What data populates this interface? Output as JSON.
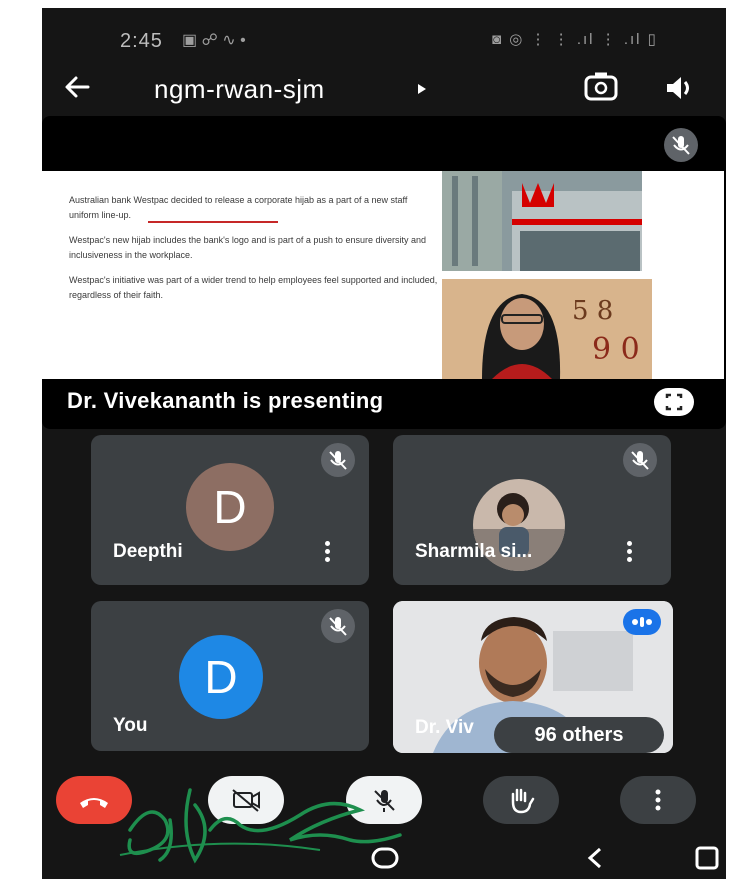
{
  "status_bar": {
    "time": "2:45",
    "left_icons": "▣ ☍ ∿ •",
    "right_icons": "◙ ◎ ⋮ ⋮ .ıl ⋮ .ıl ▯"
  },
  "meeting": {
    "code": "ngm-rwan-sjm"
  },
  "presentation": {
    "slide_paragraphs": [
      "Australian bank Westpac decided to release a corporate hijab as a part of a new staff uniform line-up.",
      "Westpac's new hijab includes the bank's logo and is part of a push to ensure diversity and inclusiveness in the workplace.",
      "Westpac's initiative was part of a wider trend to help employees feel supported and included, regardless of their faith."
    ],
    "presenting_label": "Dr. Vivekananth is presenting"
  },
  "participants": [
    {
      "name": "Deepthi",
      "initial": "D",
      "avatar_color": "#8d6e63",
      "muted": true
    },
    {
      "name": "Sharmila si...",
      "avatar": "photo",
      "muted": true
    },
    {
      "name": "You",
      "initial": "D",
      "avatar_color": "#1e88e5",
      "muted": true
    },
    {
      "name": "Dr. Viv",
      "avatar": "video",
      "speaking": true
    }
  ],
  "others_label": "96 others",
  "controls": {
    "end_call_color": "#ea4335",
    "buttons": [
      "end-call",
      "camera-off",
      "mic-off",
      "raise-hand",
      "more-options"
    ]
  },
  "colors": {
    "background": "#151515",
    "tile": "#3c4043",
    "speaking_indicator": "#1a73e8"
  }
}
